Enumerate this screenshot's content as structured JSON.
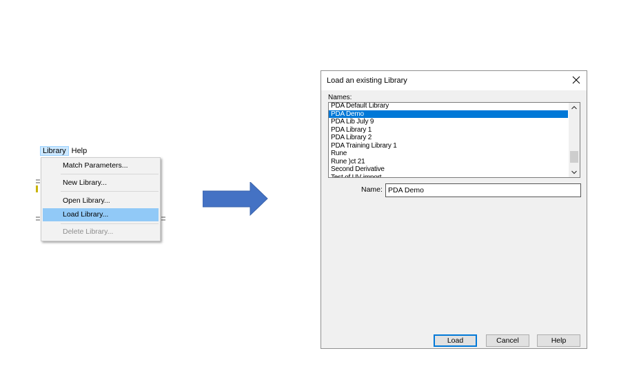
{
  "menubar": {
    "items": [
      "Library",
      "Help"
    ]
  },
  "library_menu": {
    "items": [
      {
        "label": "Match Parameters...",
        "enabled": true
      },
      {
        "label": "New Library...",
        "enabled": true
      },
      {
        "label": "Open Library...",
        "enabled": true
      },
      {
        "label": "Load Library...",
        "enabled": true,
        "highlighted": true
      },
      {
        "label": "Delete Library...",
        "enabled": false
      }
    ]
  },
  "arrow": {
    "icon": "right-arrow-icon",
    "color": "#4472c4"
  },
  "dialog": {
    "title": "Load an existing Library",
    "names_label": "Names:",
    "libraries": [
      "PDA Default Library",
      "PDA Demo",
      "PDA Lib July 9",
      "PDA Library 1",
      "PDA Library 2",
      "PDA Training Library 1",
      "Rune",
      "Rune )ct 21",
      "Second Derivative",
      "Test of UV import"
    ],
    "selected_index": 1,
    "name_label": "Name:",
    "name_value": "PDA Demo",
    "buttons": {
      "load": "Load",
      "cancel": "Cancel",
      "help": "Help"
    },
    "accent": "#0078d7"
  }
}
